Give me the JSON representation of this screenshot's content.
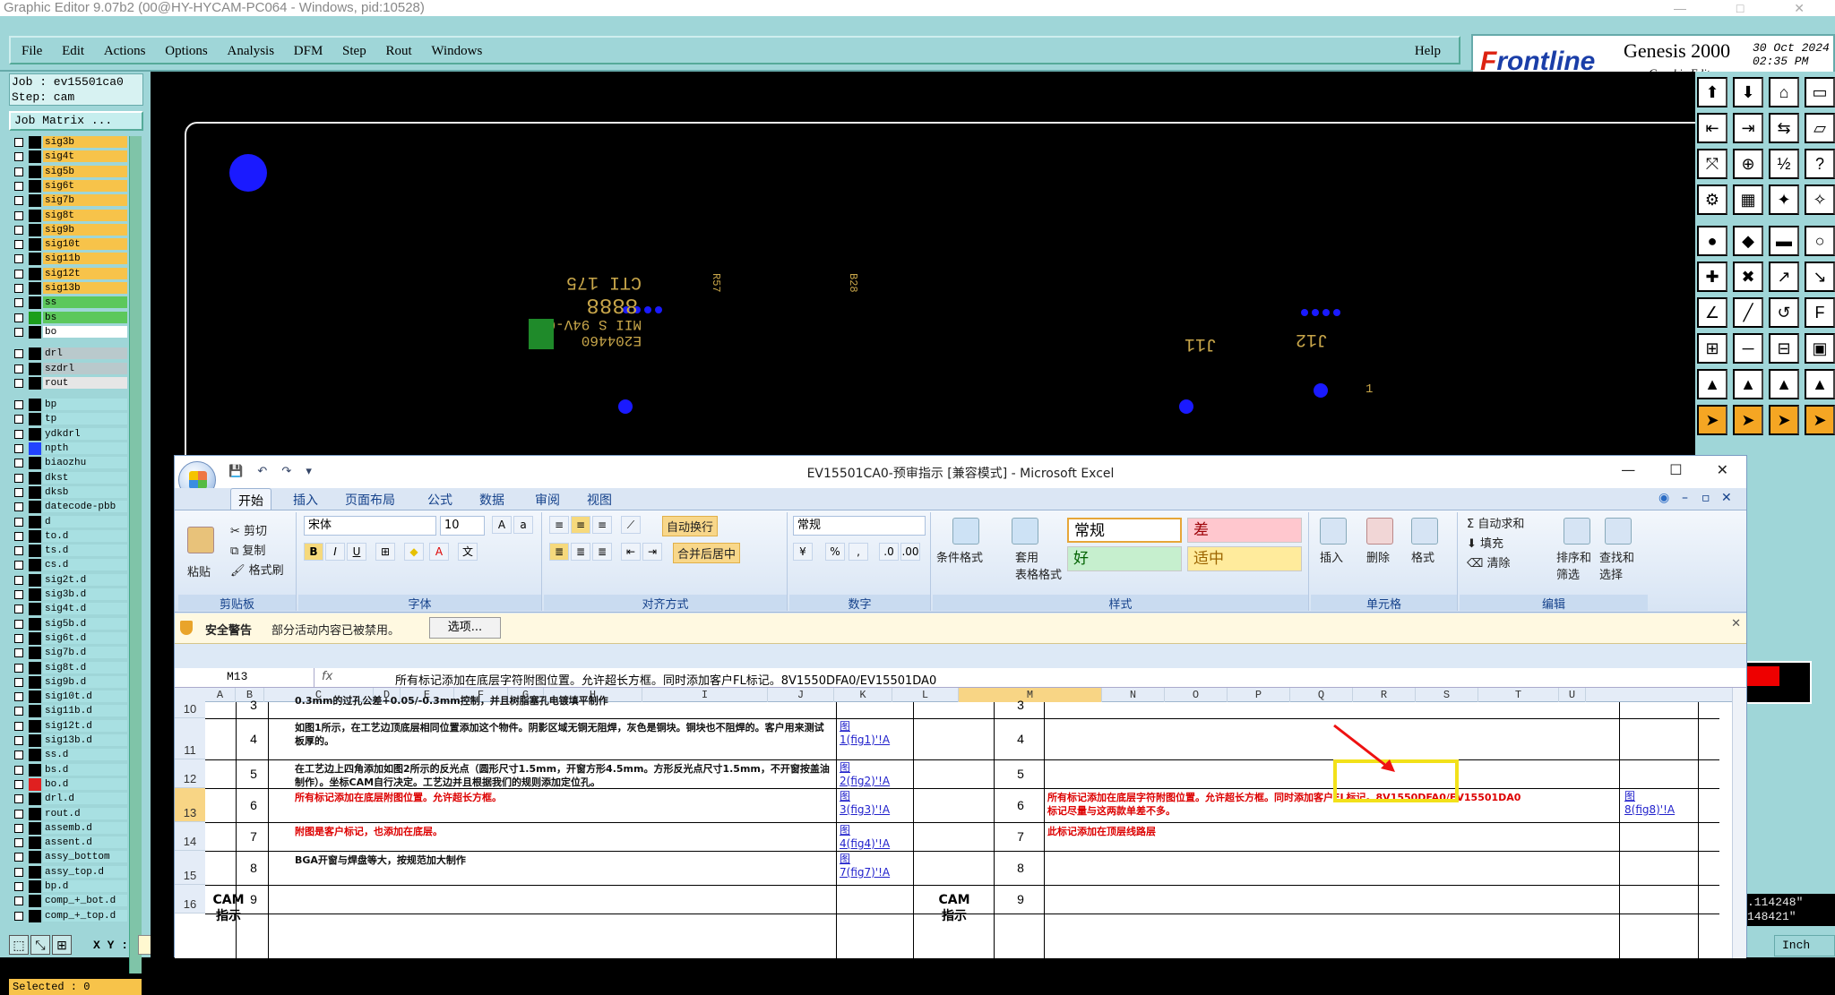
{
  "genesis": {
    "titlebar": "Graphic Editor 9.07b2 (00@HY-HYCAM-PC064 - Windows, pid:10528)",
    "window_controls": [
      "—",
      "□",
      "✕"
    ],
    "menu": [
      "File",
      "Edit",
      "Actions",
      "Options",
      "Analysis",
      "DFM",
      "Step",
      "Rout",
      "Windows"
    ],
    "help": "Help",
    "brand": {
      "logo_lead": "F",
      "logo_rest": "rontline",
      "product": "Genesis 2000",
      "subtitle": "Graphic Editor",
      "date": "30 Oct 2024",
      "time": "02:35 PM"
    },
    "job": "Job : ev15501ca0",
    "step": "Step: cam",
    "job_matrix": "Job Matrix ...",
    "selected": "Selected : 0",
    "xy_label": "X Y :",
    "coord_readout": [
      ".114248\"",
      "148421\""
    ],
    "units": "Inch",
    "layers": [
      {
        "name": "sig3b",
        "color": "#f7c34a"
      },
      {
        "name": "sig4t",
        "color": "#f7c34a"
      },
      {
        "name": "sig5b",
        "color": "#f7c34a"
      },
      {
        "name": "sig6t",
        "color": "#f7c34a"
      },
      {
        "name": "sig7b",
        "color": "#f7c34a"
      },
      {
        "name": "sig8t",
        "color": "#f7c34a"
      },
      {
        "name": "sig9b",
        "color": "#f7c34a"
      },
      {
        "name": "sig10t",
        "color": "#f7c34a"
      },
      {
        "name": "sig11b",
        "color": "#f7c34a"
      },
      {
        "name": "sig12t",
        "color": "#f7c34a"
      },
      {
        "name": "sig13b",
        "color": "#f7c34a"
      },
      {
        "name": "ss",
        "color": "#5cc85c"
      },
      {
        "name": "bs",
        "color": "#5cc85c",
        "swatch": "#1c9e1c"
      },
      {
        "name": "bo",
        "color": "#ffffff"
      },
      {
        "name": "drl",
        "color": "#b9c9cc"
      },
      {
        "name": "szdrl",
        "color": "#b9c9cc"
      },
      {
        "name": "rout",
        "color": "#e6e6e6"
      },
      {
        "name": "bp",
        "color": "#a8e0e2"
      },
      {
        "name": "tp",
        "color": "#a8e0e2"
      },
      {
        "name": "ydkdrl",
        "color": "#a8e0e2"
      },
      {
        "name": "npth",
        "color": "#a8e0e2",
        "swatch": "#2244ff"
      },
      {
        "name": "biaozhu",
        "color": "#a8e0e2"
      },
      {
        "name": "dkst",
        "color": "#a8e0e2"
      },
      {
        "name": "dksb",
        "color": "#a8e0e2"
      },
      {
        "name": "datecode-pbb",
        "color": "#a8e0e2"
      },
      {
        "name": "d",
        "color": "#a8e0e2"
      },
      {
        "name": "to.d",
        "color": "#a8e0e2"
      },
      {
        "name": "ts.d",
        "color": "#a8e0e2"
      },
      {
        "name": "cs.d",
        "color": "#a8e0e2"
      },
      {
        "name": "sig2t.d",
        "color": "#a8e0e2"
      },
      {
        "name": "sig3b.d",
        "color": "#a8e0e2"
      },
      {
        "name": "sig4t.d",
        "color": "#a8e0e2"
      },
      {
        "name": "sig5b.d",
        "color": "#a8e0e2"
      },
      {
        "name": "sig6t.d",
        "color": "#a8e0e2"
      },
      {
        "name": "sig7b.d",
        "color": "#a8e0e2"
      },
      {
        "name": "sig8t.d",
        "color": "#a8e0e2"
      },
      {
        "name": "sig9b.d",
        "color": "#a8e0e2"
      },
      {
        "name": "sig10t.d",
        "color": "#a8e0e2"
      },
      {
        "name": "sig11b.d",
        "color": "#a8e0e2"
      },
      {
        "name": "sig12t.d",
        "color": "#a8e0e2"
      },
      {
        "name": "sig13b.d",
        "color": "#a8e0e2"
      },
      {
        "name": "ss.d",
        "color": "#a8e0e2"
      },
      {
        "name": "bs.d",
        "color": "#a8e0e2"
      },
      {
        "name": "bo.d",
        "color": "#a8e0e2",
        "swatch": "#e02020"
      },
      {
        "name": "drl.d",
        "color": "#a8e0e2"
      },
      {
        "name": "rout.d",
        "color": "#a8e0e2"
      },
      {
        "name": "assemb.d",
        "color": "#a8e0e2"
      },
      {
        "name": "assent.d",
        "color": "#a8e0e2"
      },
      {
        "name": "assy_bottom",
        "color": "#a8e0e2"
      },
      {
        "name": "assy_top.d",
        "color": "#a8e0e2"
      },
      {
        "name": "bp.d",
        "color": "#a8e0e2"
      },
      {
        "name": "comp_+_bot.d",
        "color": "#a8e0e2"
      },
      {
        "name": "comp_+_top.d",
        "color": "#a8e0e2"
      }
    ],
    "canvas_labels": {
      "silk": [
        "E204460",
        "MII S 94V-0",
        "8888",
        "CTI 175"
      ],
      "ref_a": "J11",
      "ref_b": "J12",
      "ref_c": "1",
      "small_a": "R57",
      "small_b": "B28"
    }
  },
  "excel": {
    "title": "EV15501CA0-预审指示  [兼容模式] - Microsoft Excel",
    "window_controls": [
      "—",
      "☐",
      "✕"
    ],
    "tabs": [
      "开始",
      "插入",
      "页面布局",
      "公式",
      "数据",
      "审阅",
      "视图"
    ],
    "ribbon": {
      "clipboard": {
        "paste": "粘贴",
        "cut": "剪切",
        "copy": "复制",
        "painter": "格式刷",
        "label": "剪贴板"
      },
      "font": {
        "name": "宋体",
        "size": "10",
        "label": "字体"
      },
      "alignment": {
        "wrap": "自动换行",
        "merge": "合并后居中",
        "label": "对齐方式"
      },
      "number": {
        "format": "常规",
        "label": "数字"
      },
      "styles": {
        "cond": "条件格式",
        "table1": "套用",
        "table2": "表格格式",
        "normal": "常规",
        "bad": "差",
        "good": "好",
        "neutral": "适中",
        "label": "样式"
      },
      "cells": {
        "insert": "插入",
        "delete": "删除",
        "format": "格式",
        "label": "单元格"
      },
      "editing": {
        "autosum": "自动求和",
        "fill": "填充",
        "clear": "清除",
        "sort1": "排序和",
        "sort2": "筛选",
        "find1": "查找和",
        "find2": "选择",
        "label": "编辑"
      }
    },
    "security": {
      "title": "安全警告",
      "message": "部分活动内容已被禁用。",
      "options": "选项..."
    },
    "namebox": "M13",
    "fx": "fx",
    "formula": "所有标记添加在底层字符附图位置。允许超长方框。同时添加客户FL标记。8V1550DFA0/EV15501DA0",
    "columns": [
      "A",
      "B",
      "C",
      "D",
      "E",
      "F",
      "G",
      "H",
      "I",
      "J",
      "K",
      "L",
      "M",
      "N",
      "O",
      "P",
      "Q",
      "R",
      "S",
      "T",
      "U"
    ],
    "rows": [
      {
        "row": "10",
        "num": "3",
        "text": "0.3mm的过孔公差+0.05/-0.3mm控制，并且树脂塞孔电镀填平制作",
        "red": false,
        "link": "",
        "num2": "3",
        "text2": ""
      },
      {
        "row": "11",
        "num": "4",
        "text": "如图1所示，在工艺边顶底层相同位置添加这个物件。阴影区域无铜无阻焊，灰色是铜块。铜块也不阻焊的。客户用来测试板厚的。",
        "red": false,
        "link": "图\n1(fig1)'!A",
        "num2": "4",
        "text2": ""
      },
      {
        "row": "12",
        "num": "5",
        "text": "在工艺边上四角添加如图2所示的反光点（圆形尺寸1.5mm，开窗方形4.5mm。方形反光点尺寸1.5mm，不开窗按盖油制作）。坐标CAM自行决定。工艺边并且根据我们的规则添加定位孔。",
        "red": false,
        "link": "图\n2(fig2)'!A",
        "num2": "5",
        "text2": ""
      },
      {
        "row": "13",
        "num": "6",
        "text": "所有标记添加在底层附图位置。允许超长方框。",
        "red": true,
        "link": "图\n3(fig3)'!A",
        "num2": "6",
        "text2": "所有标记添加在底层字符附图位置。允许超长方框。同时添加客户FL标记。8V1550DFA0/EV15501DA0\n标记尽量与这两款单差不多。",
        "link2": "图\n8(fig8)'!A"
      },
      {
        "row": "14",
        "num": "7",
        "text": "附图是客户标记，也添加在底层。",
        "red": true,
        "link": "图\n4(fig4)'!A",
        "num2": "7",
        "text2": "此标记添加在顶层线路层"
      },
      {
        "row": "15",
        "num": "8",
        "text": "BGA开窗与焊盘等大，按规范加大制作",
        "red": false,
        "link": "图\n7(fig7)'!A",
        "num2": "8",
        "text2": ""
      },
      {
        "row": "16",
        "num": "9",
        "text": "",
        "red": false,
        "link": "",
        "num2": "9",
        "text2": ""
      }
    ],
    "cam_label": "CAM\n指示"
  },
  "colors": {
    "genesis_teal": "#9fd6d8",
    "layer_orange": "#f7c34a",
    "pad_blue": "#1a1aff",
    "silk_yellow": "#d4b54a",
    "annot_red": "#e11",
    "highlight_yellow": "#f2e11a"
  }
}
